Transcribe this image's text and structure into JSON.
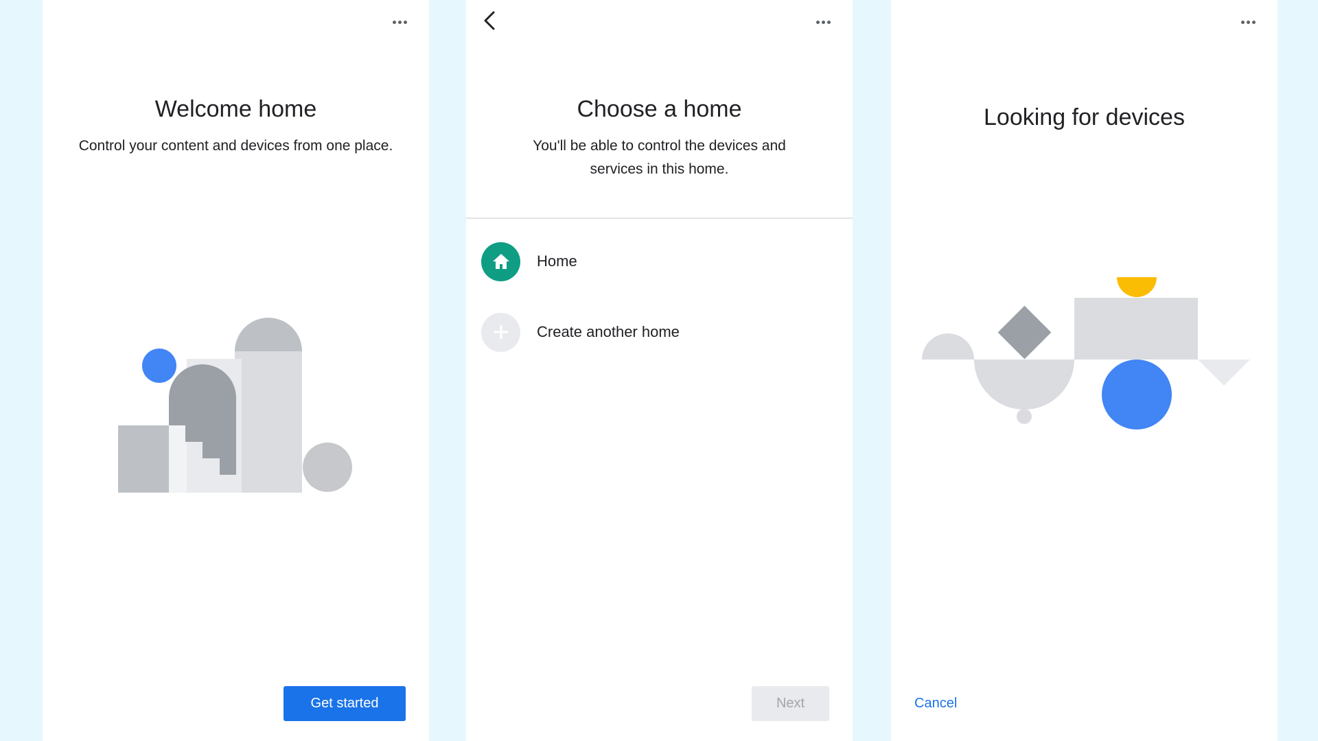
{
  "colors": {
    "page_bg": "#e6f7fd",
    "primary": "#1a73e8",
    "teal": "#0f9d84",
    "gray_dark": "#9aa0a6",
    "gray_mid": "#bdc1c6",
    "gray_light": "#dadce0",
    "yellow": "#fbbc04",
    "blue": "#4285f4"
  },
  "screen1": {
    "title": "Welcome home",
    "subtitle": "Control your content and devices from one place.",
    "primary_button": "Get started",
    "menu_icon": "more-horizontal-icon"
  },
  "screen2": {
    "title": "Choose a home",
    "subtitle": "You'll be able to control the devices and services in this home.",
    "homes": [
      {
        "label": "Home",
        "icon": "house-icon",
        "selected": true
      },
      {
        "label": "Create another home",
        "icon": "plus-icon",
        "selected": false
      }
    ],
    "next_button": "Next",
    "back_icon": "chevron-left-icon",
    "menu_icon": "more-horizontal-icon"
  },
  "screen3": {
    "title": "Looking for devices",
    "cancel_button": "Cancel",
    "menu_icon": "more-horizontal-icon"
  }
}
